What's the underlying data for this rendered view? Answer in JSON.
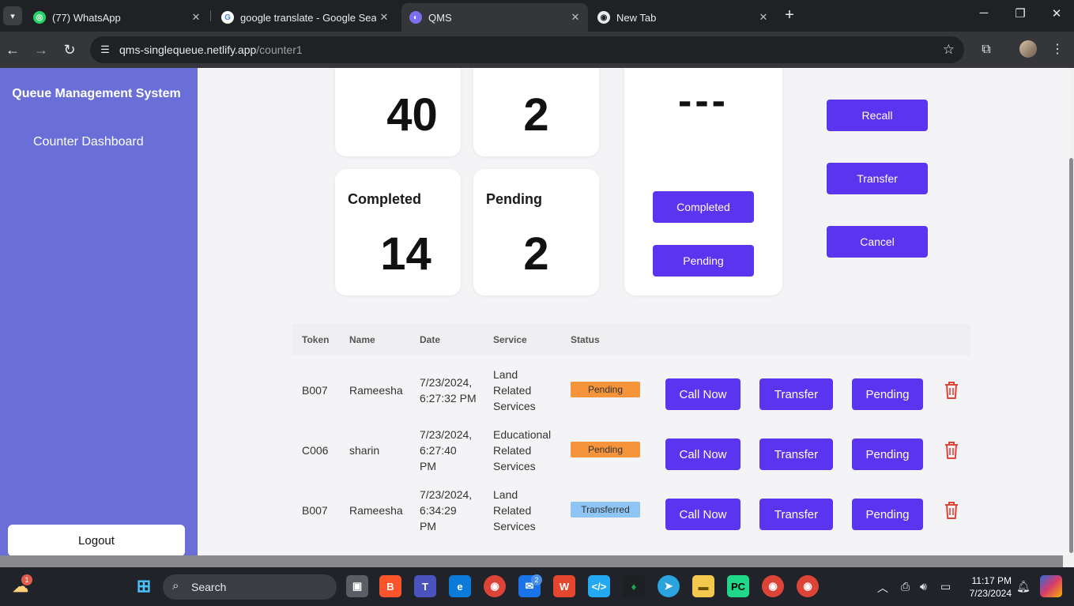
{
  "browser": {
    "tabs": [
      {
        "title": "(77) WhatsApp",
        "active": false
      },
      {
        "title": "google translate - Google Search",
        "active": false
      },
      {
        "title": "QMS",
        "active": true
      },
      {
        "title": "New Tab",
        "active": false
      }
    ],
    "url_host": "qms-singlequeue.netlify.app",
    "url_path": "/counter1"
  },
  "sidebar": {
    "brand": "Queue Management System",
    "nav_item": "Counter Dashboard",
    "logout": "Logout"
  },
  "stats": {
    "top_left_value": "40",
    "top_right_value": "2",
    "completed_label": "Completed",
    "completed_value": "14",
    "pending_label": "Pending",
    "pending_value": "2"
  },
  "current": {
    "token": "---",
    "completed_button": "Completed",
    "pending_button": "Pending"
  },
  "actions": {
    "recall": "Recall",
    "transfer": "Transfer",
    "cancel": "Cancel"
  },
  "table": {
    "headers": [
      "Token",
      "Name",
      "Date",
      "Service",
      "Status"
    ],
    "rows": [
      {
        "token": "B007",
        "name": "Rameesha",
        "date": [
          "7/23/2024,",
          "6:27:32 PM"
        ],
        "service": [
          "Land",
          "Related",
          "Services"
        ],
        "status": "Pending",
        "call": "Call Now",
        "transfer": "Transfer",
        "pending": "Pending"
      },
      {
        "token": "C006",
        "name": "sharin",
        "date": [
          "7/23/2024,",
          "6:27:40",
          "PM"
        ],
        "service": [
          "Educational",
          "Related",
          "Services"
        ],
        "status": "Pending",
        "call": "Call Now",
        "transfer": "Transfer",
        "pending": "Pending"
      },
      {
        "token": "B007",
        "name": "Rameesha",
        "date": [
          "7/23/2024,",
          "6:34:29",
          "PM"
        ],
        "service": [
          "Land",
          "Related",
          "Services"
        ],
        "status": "Transferred",
        "call": "Call Now",
        "transfer": "Transfer",
        "pending": "Pending"
      }
    ]
  },
  "taskbar": {
    "search": "Search",
    "time": "11:17 PM",
    "date": "7/23/2024",
    "weather_badge": "1",
    "mail_badge": "2"
  },
  "colors": {
    "sidebar": "#6a6fd8",
    "primary_button": "#5a34ef",
    "pending_badge": "#f5943a",
    "transferred_badge": "#8ec5f5",
    "delete_icon": "#e0453a"
  }
}
